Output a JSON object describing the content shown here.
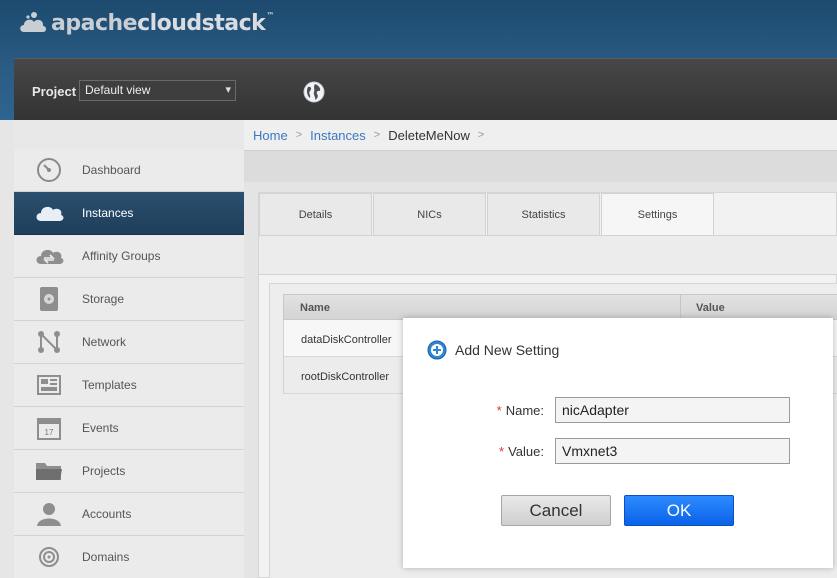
{
  "app": {
    "logo_apache": "apache",
    "logo_cloudstack": "cloudstack",
    "logo_tm": "™"
  },
  "project": {
    "label": "Project",
    "selected": "Default view"
  },
  "sidebar": {
    "items": [
      {
        "label": "Dashboard",
        "icon": "dashboard-icon"
      },
      {
        "label": "Instances",
        "icon": "cloud-icon",
        "active": true
      },
      {
        "label": "Affinity Groups",
        "icon": "affinity-icon"
      },
      {
        "label": "Storage",
        "icon": "storage-icon"
      },
      {
        "label": "Network",
        "icon": "network-icon"
      },
      {
        "label": "Templates",
        "icon": "templates-icon"
      },
      {
        "label": "Events",
        "icon": "calendar-icon",
        "icon_text": "17"
      },
      {
        "label": "Projects",
        "icon": "folder-icon"
      },
      {
        "label": "Accounts",
        "icon": "user-icon"
      },
      {
        "label": "Domains",
        "icon": "domain-icon"
      }
    ]
  },
  "breadcrumb": {
    "home": "Home",
    "instances": "Instances",
    "current": "DeleteMeNow",
    "separator": ">"
  },
  "tabs": [
    {
      "label": "Details"
    },
    {
      "label": "NICs"
    },
    {
      "label": "Statistics"
    },
    {
      "label": "Settings",
      "active": true
    }
  ],
  "grid": {
    "columns": {
      "name": "Name",
      "value": "Value"
    },
    "rows": [
      {
        "name": "dataDiskController"
      },
      {
        "name": "rootDiskController"
      }
    ]
  },
  "dialog": {
    "title": "Add New Setting",
    "required_mark": "*",
    "name_label": "Name:",
    "name_value": "nicAdapter",
    "value_label": "Value:",
    "value_value": "Vmxnet3",
    "cancel_label": "Cancel",
    "ok_label": "OK"
  },
  "colors": {
    "header_blue": "#2a5b83",
    "active_nav": "#1f3f5b",
    "link": "#3a78c4",
    "ok_button": "#0a62e8",
    "required": "#dd3333"
  }
}
